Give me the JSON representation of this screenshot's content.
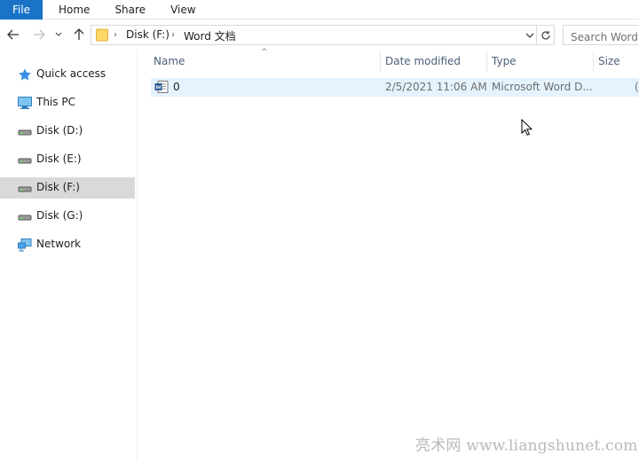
{
  "ribbon": {
    "tabs": [
      {
        "label": "File"
      },
      {
        "label": "Home"
      },
      {
        "label": "Share"
      },
      {
        "label": "View"
      }
    ]
  },
  "address": {
    "crumbs": [
      "Disk (F:)",
      "Word 文档"
    ]
  },
  "search": {
    "placeholder": "Search Word 文档"
  },
  "navpane": {
    "items": [
      {
        "label": "Quick access",
        "icon": "star-icon"
      },
      {
        "label": "This PC",
        "icon": "computer-icon"
      },
      {
        "label": "Disk (D:)",
        "icon": "drive-icon"
      },
      {
        "label": "Disk (E:)",
        "icon": "drive-icon"
      },
      {
        "label": "Disk (F:)",
        "icon": "drive-icon",
        "selected": true
      },
      {
        "label": "Disk (G:)",
        "icon": "drive-icon"
      },
      {
        "label": "Network",
        "icon": "network-icon"
      }
    ]
  },
  "columns": {
    "name": "Name",
    "date": "Date modified",
    "type": "Type",
    "size": "Size"
  },
  "files": [
    {
      "name": "0",
      "date": "2/5/2021 11:06 AM",
      "type": "Microsoft Word D...",
      "size": "("
    }
  ],
  "watermark": "亮术网 www.liangshunet.com",
  "colors": {
    "accent": "#1a73c7",
    "selected_row": "#e5f3ff",
    "selected_nav": "#d9d9d9"
  }
}
